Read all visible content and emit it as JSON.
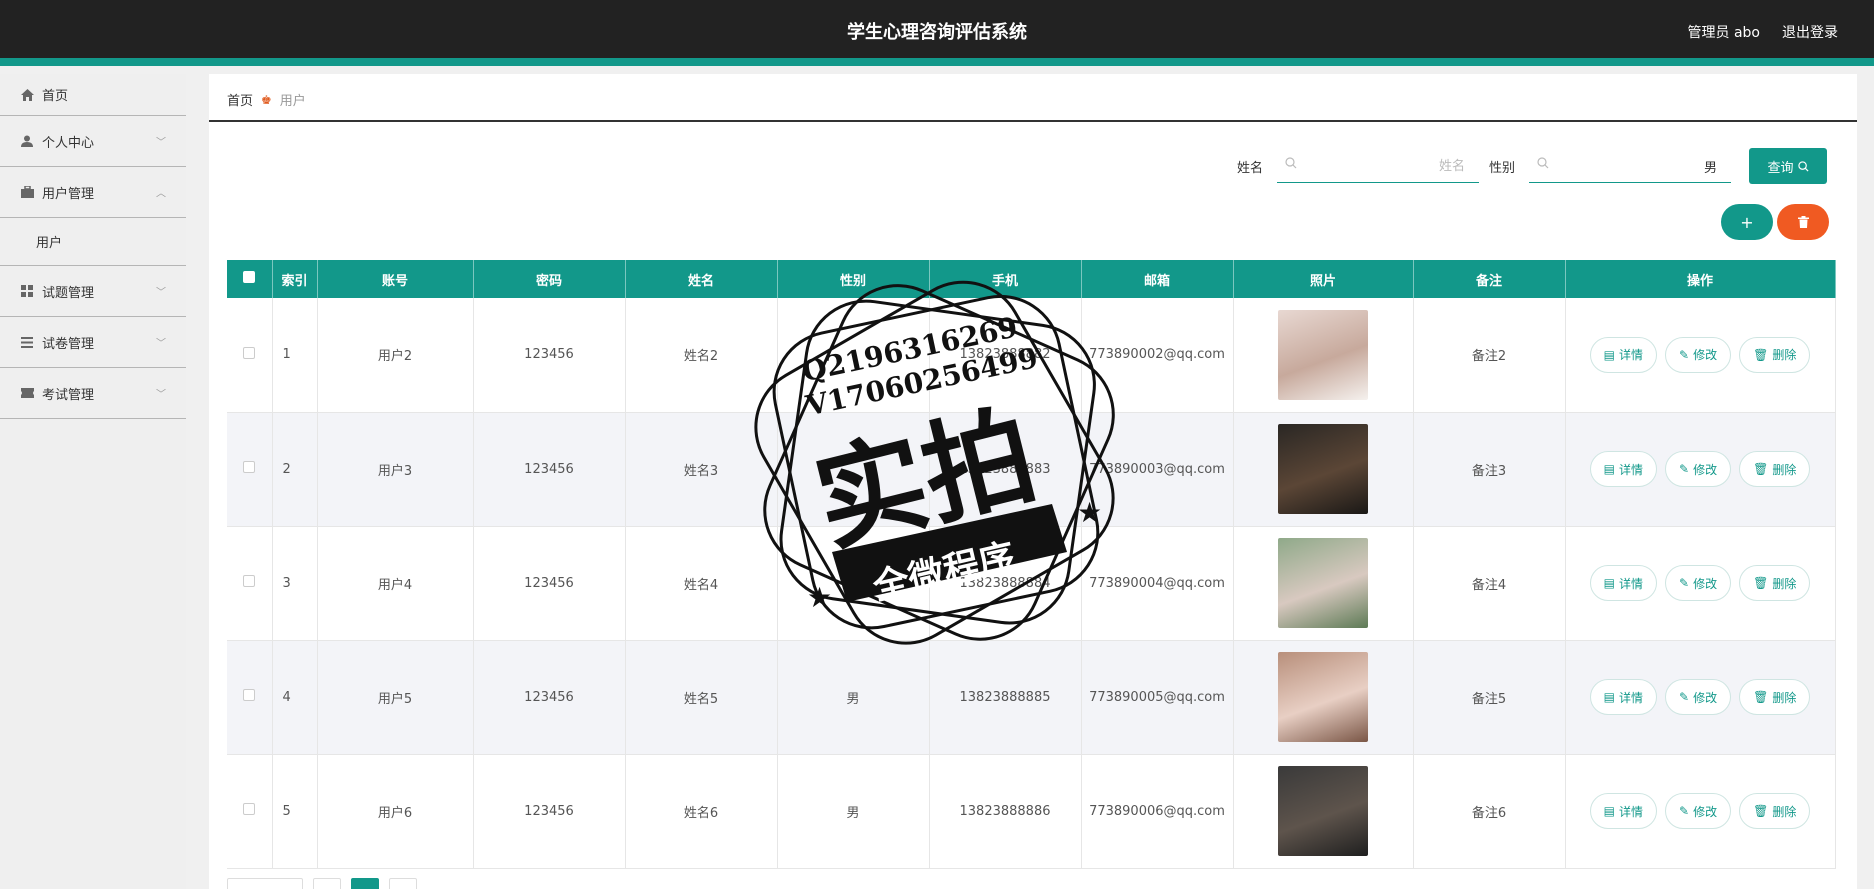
{
  "header": {
    "title": "学生心理咨询评估系统",
    "user_label": "管理员 abo",
    "logout_label": "退出登录"
  },
  "sidebar": {
    "items": [
      {
        "label": "首页",
        "icon": "home-icon"
      },
      {
        "label": "个人中心",
        "icon": "user-icon"
      },
      {
        "label": "用户管理",
        "icon": "briefcase-icon",
        "expanded": true,
        "children": [
          {
            "label": "用户"
          }
        ]
      },
      {
        "label": "试题管理",
        "icon": "grid-icon"
      },
      {
        "label": "试卷管理",
        "icon": "list-icon"
      },
      {
        "label": "考试管理",
        "icon": "ticket-icon"
      }
    ]
  },
  "breadcrumb": {
    "home": "首页",
    "current": "用户"
  },
  "search": {
    "name_label": "姓名",
    "name_placeholder": "姓名",
    "gender_label": "性别",
    "gender_value": "男",
    "query_label": "查询"
  },
  "table": {
    "headers": [
      "索引",
      "账号",
      "密码",
      "姓名",
      "性别",
      "手机",
      "邮箱",
      "照片",
      "备注",
      "操作"
    ],
    "rows": [
      {
        "index": "1",
        "account": "用户2",
        "password": "123456",
        "name": "姓名2",
        "gender": "",
        "phone": "13823888882",
        "email": "773890002@qq.com",
        "note": "备注2"
      },
      {
        "index": "2",
        "account": "用户3",
        "password": "123456",
        "name": "姓名3",
        "gender": "",
        "phone": "13823888883",
        "email": "773890003@qq.com",
        "note": "备注3"
      },
      {
        "index": "3",
        "account": "用户4",
        "password": "123456",
        "name": "姓名4",
        "gender": "",
        "phone": "13823888884",
        "email": "773890004@qq.com",
        "note": "备注4"
      },
      {
        "index": "4",
        "account": "用户5",
        "password": "123456",
        "name": "姓名5",
        "gender": "男",
        "phone": "13823888885",
        "email": "773890005@qq.com",
        "note": "备注5"
      },
      {
        "index": "5",
        "account": "用户6",
        "password": "123456",
        "name": "姓名6",
        "gender": "男",
        "phone": "13823888886",
        "email": "773890006@qq.com",
        "note": "备注6"
      }
    ],
    "actions": {
      "detail": "详情",
      "edit": "修改",
      "delete": "删除"
    }
  },
  "watermark": {
    "line1": "Q2196316269",
    "line2": "V17060256499",
    "main": "实拍",
    "ribbon": "全微程序"
  },
  "colors": {
    "accent": "#12988a",
    "danger": "#f05a22",
    "header_bg": "#222222"
  }
}
